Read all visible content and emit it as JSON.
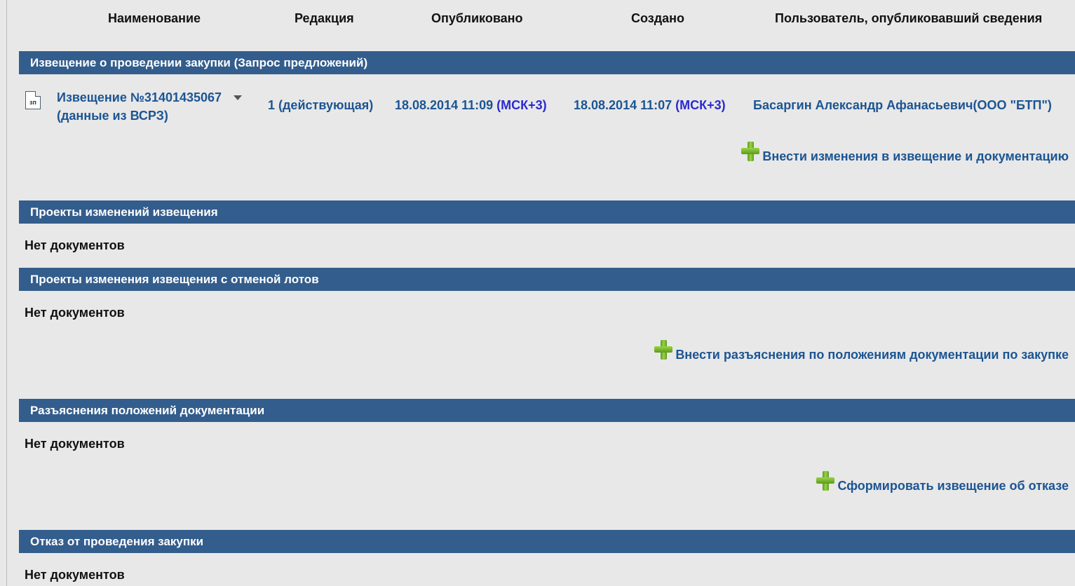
{
  "columns": {
    "name": "Наименование",
    "revision": "Редакция",
    "published": "Опубликовано",
    "created": "Создано",
    "publisher": "Пользователь, опубликовавший сведения"
  },
  "sections": {
    "notice": "Извещение о проведении закупки (Запрос предложений)",
    "change_projects": "Проекты изменений извещения",
    "change_projects_cancel_lots": "Проекты изменения извещения с отменой лотов",
    "clarifications": "Разъяснения положений документации",
    "cancellation": "Отказ от проведения закупки"
  },
  "notice_document": {
    "icon": "document-icon",
    "icon_text": "зп",
    "title_line1": "Извещение №31401435067",
    "title_line2": "(данные из ВСРЗ)",
    "revision": "1 (действующая)",
    "published_date": "18.08.2014 11:09",
    "published_tz": "(МСК+3)",
    "created_date": "18.08.2014 11:07",
    "created_tz": "(МСК+3)",
    "publisher": "Басаргин Александр Афанасьевич(ООО \"БТП\")"
  },
  "empty_text": "Нет документов",
  "actions": {
    "make_changes": "Внести изменения в извещение и документацию",
    "add_clarifications": "Внести разъяснения по положениям документации по закупке",
    "form_cancellation": "Сформировать извещение об отказе"
  },
  "colors": {
    "section_bar": "#335d8c",
    "link": "#1c5593",
    "timezone": "#2a2ad0",
    "background": "#e8e8e8"
  }
}
